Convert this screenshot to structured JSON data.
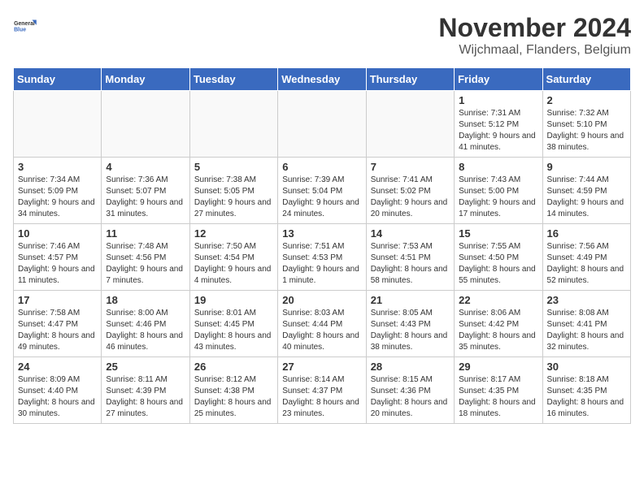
{
  "header": {
    "logo_line1": "General",
    "logo_line2": "Blue",
    "month_title": "November 2024",
    "location": "Wijchmaal, Flanders, Belgium"
  },
  "weekdays": [
    "Sunday",
    "Monday",
    "Tuesday",
    "Wednesday",
    "Thursday",
    "Friday",
    "Saturday"
  ],
  "weeks": [
    [
      {
        "day": "",
        "info": ""
      },
      {
        "day": "",
        "info": ""
      },
      {
        "day": "",
        "info": ""
      },
      {
        "day": "",
        "info": ""
      },
      {
        "day": "",
        "info": ""
      },
      {
        "day": "1",
        "info": "Sunrise: 7:31 AM\nSunset: 5:12 PM\nDaylight: 9 hours and 41 minutes."
      },
      {
        "day": "2",
        "info": "Sunrise: 7:32 AM\nSunset: 5:10 PM\nDaylight: 9 hours and 38 minutes."
      }
    ],
    [
      {
        "day": "3",
        "info": "Sunrise: 7:34 AM\nSunset: 5:09 PM\nDaylight: 9 hours and 34 minutes."
      },
      {
        "day": "4",
        "info": "Sunrise: 7:36 AM\nSunset: 5:07 PM\nDaylight: 9 hours and 31 minutes."
      },
      {
        "day": "5",
        "info": "Sunrise: 7:38 AM\nSunset: 5:05 PM\nDaylight: 9 hours and 27 minutes."
      },
      {
        "day": "6",
        "info": "Sunrise: 7:39 AM\nSunset: 5:04 PM\nDaylight: 9 hours and 24 minutes."
      },
      {
        "day": "7",
        "info": "Sunrise: 7:41 AM\nSunset: 5:02 PM\nDaylight: 9 hours and 20 minutes."
      },
      {
        "day": "8",
        "info": "Sunrise: 7:43 AM\nSunset: 5:00 PM\nDaylight: 9 hours and 17 minutes."
      },
      {
        "day": "9",
        "info": "Sunrise: 7:44 AM\nSunset: 4:59 PM\nDaylight: 9 hours and 14 minutes."
      }
    ],
    [
      {
        "day": "10",
        "info": "Sunrise: 7:46 AM\nSunset: 4:57 PM\nDaylight: 9 hours and 11 minutes."
      },
      {
        "day": "11",
        "info": "Sunrise: 7:48 AM\nSunset: 4:56 PM\nDaylight: 9 hours and 7 minutes."
      },
      {
        "day": "12",
        "info": "Sunrise: 7:50 AM\nSunset: 4:54 PM\nDaylight: 9 hours and 4 minutes."
      },
      {
        "day": "13",
        "info": "Sunrise: 7:51 AM\nSunset: 4:53 PM\nDaylight: 9 hours and 1 minute."
      },
      {
        "day": "14",
        "info": "Sunrise: 7:53 AM\nSunset: 4:51 PM\nDaylight: 8 hours and 58 minutes."
      },
      {
        "day": "15",
        "info": "Sunrise: 7:55 AM\nSunset: 4:50 PM\nDaylight: 8 hours and 55 minutes."
      },
      {
        "day": "16",
        "info": "Sunrise: 7:56 AM\nSunset: 4:49 PM\nDaylight: 8 hours and 52 minutes."
      }
    ],
    [
      {
        "day": "17",
        "info": "Sunrise: 7:58 AM\nSunset: 4:47 PM\nDaylight: 8 hours and 49 minutes."
      },
      {
        "day": "18",
        "info": "Sunrise: 8:00 AM\nSunset: 4:46 PM\nDaylight: 8 hours and 46 minutes."
      },
      {
        "day": "19",
        "info": "Sunrise: 8:01 AM\nSunset: 4:45 PM\nDaylight: 8 hours and 43 minutes."
      },
      {
        "day": "20",
        "info": "Sunrise: 8:03 AM\nSunset: 4:44 PM\nDaylight: 8 hours and 40 minutes."
      },
      {
        "day": "21",
        "info": "Sunrise: 8:05 AM\nSunset: 4:43 PM\nDaylight: 8 hours and 38 minutes."
      },
      {
        "day": "22",
        "info": "Sunrise: 8:06 AM\nSunset: 4:42 PM\nDaylight: 8 hours and 35 minutes."
      },
      {
        "day": "23",
        "info": "Sunrise: 8:08 AM\nSunset: 4:41 PM\nDaylight: 8 hours and 32 minutes."
      }
    ],
    [
      {
        "day": "24",
        "info": "Sunrise: 8:09 AM\nSunset: 4:40 PM\nDaylight: 8 hours and 30 minutes."
      },
      {
        "day": "25",
        "info": "Sunrise: 8:11 AM\nSunset: 4:39 PM\nDaylight: 8 hours and 27 minutes."
      },
      {
        "day": "26",
        "info": "Sunrise: 8:12 AM\nSunset: 4:38 PM\nDaylight: 8 hours and 25 minutes."
      },
      {
        "day": "27",
        "info": "Sunrise: 8:14 AM\nSunset: 4:37 PM\nDaylight: 8 hours and 23 minutes."
      },
      {
        "day": "28",
        "info": "Sunrise: 8:15 AM\nSunset: 4:36 PM\nDaylight: 8 hours and 20 minutes."
      },
      {
        "day": "29",
        "info": "Sunrise: 8:17 AM\nSunset: 4:35 PM\nDaylight: 8 hours and 18 minutes."
      },
      {
        "day": "30",
        "info": "Sunrise: 8:18 AM\nSunset: 4:35 PM\nDaylight: 8 hours and 16 minutes."
      }
    ]
  ]
}
